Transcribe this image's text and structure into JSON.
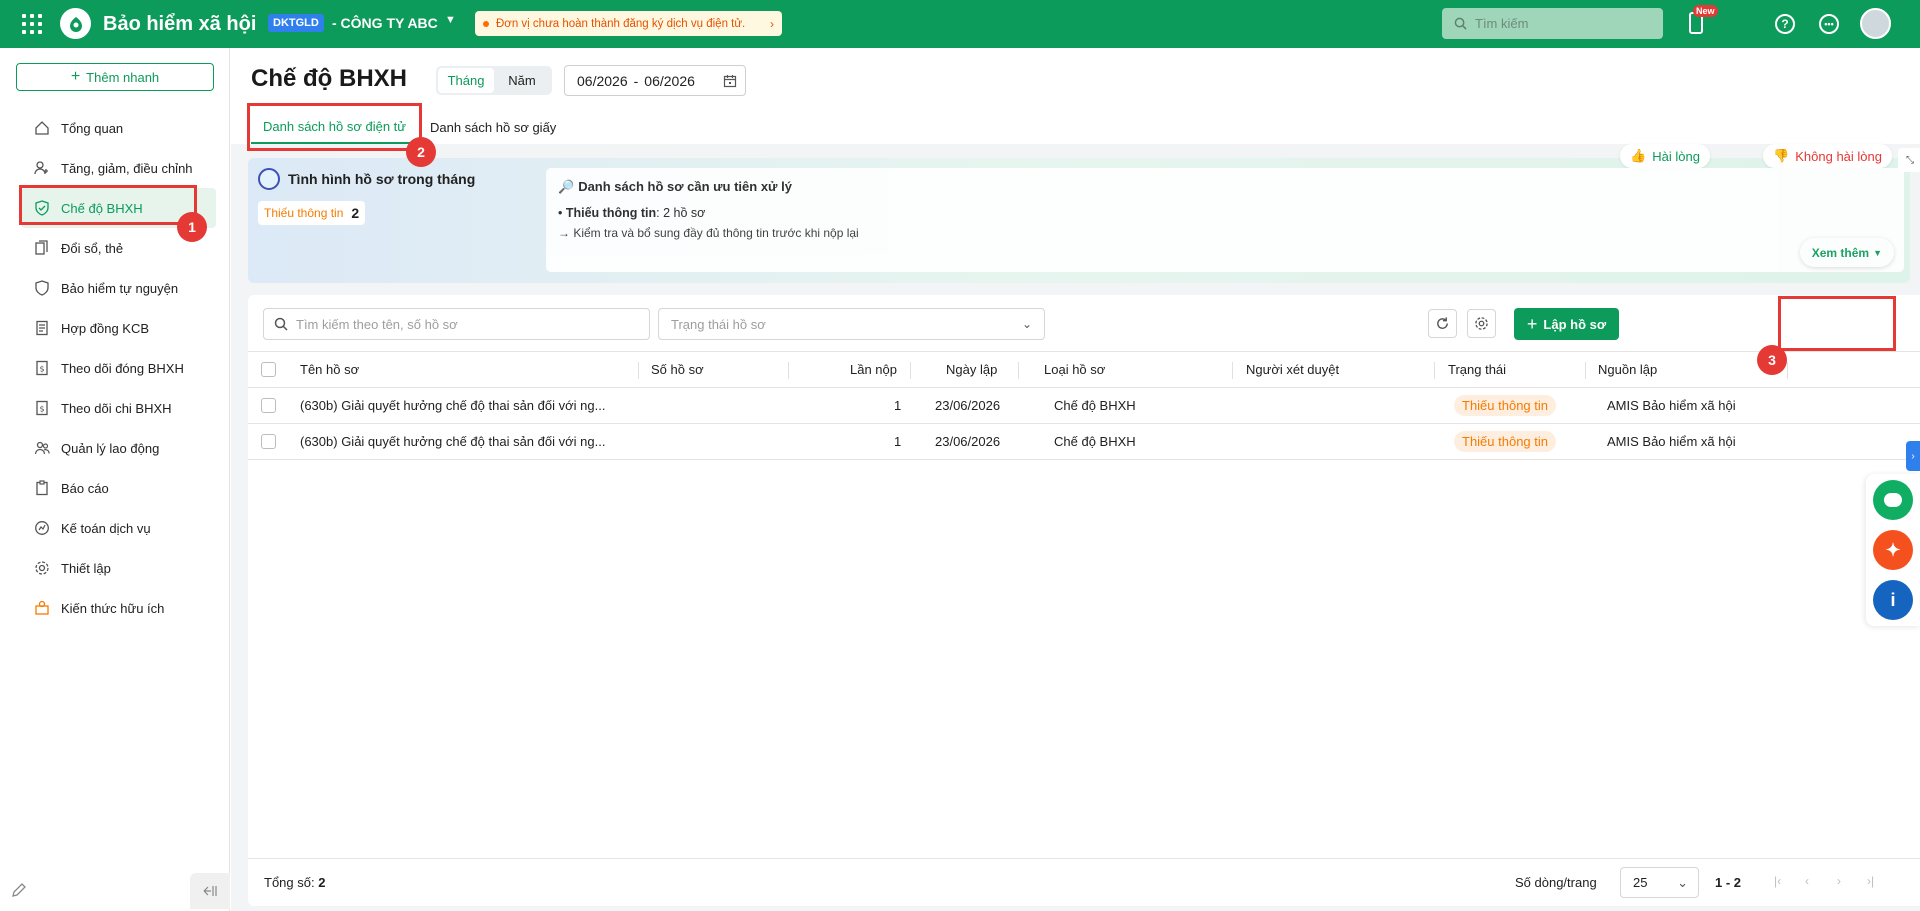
{
  "topbar": {
    "app_title": "Bảo hiểm xã hội",
    "org_code": "DKTGLD",
    "org_name": "- CÔNG TY ABC",
    "notice": "Đơn vị chưa hoàn thành đăng ký dịch vụ điện tử.",
    "search_placeholder": "Tìm kiếm",
    "new_badge": "New"
  },
  "sidebar": {
    "quick_add": "Thêm nhanh",
    "items": [
      {
        "label": "Tổng quan"
      },
      {
        "label": "Tăng, giảm, điều chỉnh"
      },
      {
        "label": "Chế độ BHXH"
      },
      {
        "label": "Đổi sổ, thẻ"
      },
      {
        "label": "Bảo hiểm tự nguyện"
      },
      {
        "label": "Hợp đồng KCB"
      },
      {
        "label": "Theo dõi đóng BHXH"
      },
      {
        "label": "Theo dõi chi BHXH"
      },
      {
        "label": "Quản lý lao động"
      },
      {
        "label": "Báo cáo"
      },
      {
        "label": "Kế toán dịch vụ"
      },
      {
        "label": "Thiết lập"
      },
      {
        "label": "Kiến thức hữu ích"
      }
    ]
  },
  "header": {
    "title": "Chế độ BHXH",
    "period_month": "Tháng",
    "period_year": "Năm",
    "date_from": "06/2026",
    "date_sep": "-",
    "date_to": "06/2026",
    "tabs": [
      {
        "label": "Danh sách hồ sơ điện tử"
      },
      {
        "label": "Danh sách hồ sơ giấy"
      }
    ]
  },
  "summary": {
    "title": "Tình hình hồ sơ trong tháng",
    "chip_label": "Thiếu thông tin",
    "chip_count": "2",
    "prio_title": "Danh sách hồ sơ cần ưu tiên xử lý",
    "prio_item_label": "Thiếu thông tin",
    "prio_item_value": ": 2 hồ sơ",
    "prio_hint": "→ Kiểm tra và bổ sung đầy đủ thông tin trước khi nộp lại",
    "more": "Xem thêm",
    "feedback_yes": "Hài lòng",
    "feedback_no": "Không hài lòng"
  },
  "toolbar": {
    "search_placeholder": "Tìm kiếm theo tên, số hồ sơ",
    "status_placeholder": "Trạng thái hồ sơ",
    "create_label": "Lập hồ sơ"
  },
  "table": {
    "headers": [
      "Tên hồ sơ",
      "Số hồ sơ",
      "Lần nộp",
      "Ngày lập",
      "Loại hồ sơ",
      "Người xét duyệt",
      "Trạng thái",
      "Nguồn lập"
    ],
    "rows": [
      {
        "name": "(630b) Giải quyết hưởng chế độ thai sản đối với ng...",
        "number": "",
        "submissions": "1",
        "date": "23/06/2026",
        "type": "Chế độ BHXH",
        "reviewer": "",
        "status": "Thiếu thông tin",
        "source": "AMIS Bảo hiểm xã hội"
      },
      {
        "name": "(630b) Giải quyết hưởng chế độ thai sản đối với ng...",
        "number": "",
        "submissions": "1",
        "date": "23/06/2026",
        "type": "Chế độ BHXH",
        "reviewer": "",
        "status": "Thiếu thông tin",
        "source": "AMIS Bảo hiểm xã hội"
      }
    ]
  },
  "footer": {
    "total_label": "Tổng số:",
    "total_value": "2",
    "rows_per_page_label": "Số dòng/trang",
    "rows_per_page": "25",
    "range": "1 - 2"
  },
  "annotations": [
    "1",
    "2",
    "3"
  ],
  "colors": {
    "brand": "#0c9b5a",
    "annotation": "#e53935",
    "warning": "#f57c00"
  }
}
